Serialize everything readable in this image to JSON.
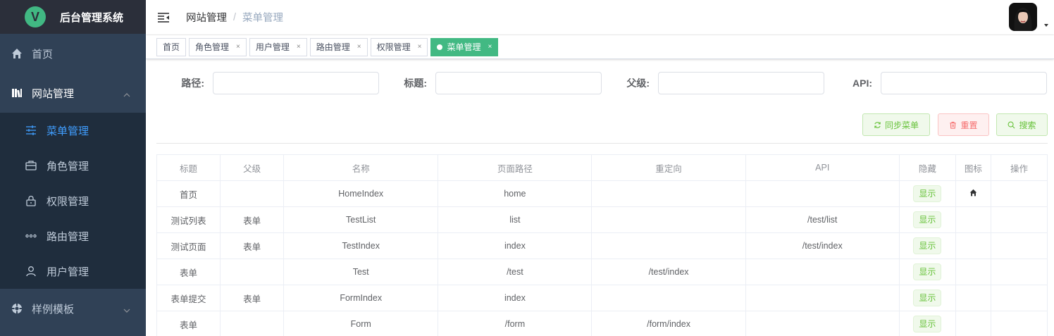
{
  "app": {
    "logo_letter": "V",
    "title": "后台管理系统"
  },
  "sidebar": {
    "home": "首页",
    "site_mgmt": "网站管理",
    "sub_items": [
      "菜单管理",
      "角色管理",
      "权限管理",
      "路由管理",
      "用户管理"
    ],
    "templates": "样例模板"
  },
  "breadcrumb": {
    "parent": "网站管理",
    "separator": "/",
    "current": "菜单管理"
  },
  "tags": [
    "首页",
    "角色管理",
    "用户管理",
    "路由管理",
    "权限管理",
    "菜单管理"
  ],
  "tag_close": "×",
  "filters": {
    "path_label": "路径:",
    "title_label": "标题:",
    "parent_label": "父级:",
    "api_label": "API:"
  },
  "buttons": {
    "sync": "同步菜单",
    "reset": "重置",
    "search": "搜索"
  },
  "colors": {
    "sidebar_bg": "#304156",
    "active_link": "#409eff",
    "active_tag": "#42b983",
    "success": "#67c23a",
    "danger": "#f56c6c"
  },
  "table": {
    "headers": [
      "标题",
      "父级",
      "名称",
      "页面路径",
      "重定向",
      "API",
      "隐藏",
      "图标",
      "操作"
    ],
    "show_label": "显示",
    "rows": [
      {
        "title": "首页",
        "parent": "",
        "name": "HomeIndex",
        "path": "home",
        "redirect": "",
        "api": "",
        "icon": "home-icon"
      },
      {
        "title": "测试列表",
        "parent": "表单",
        "name": "TestList",
        "path": "list",
        "redirect": "",
        "api": "/test/list",
        "icon": ""
      },
      {
        "title": "测试页面",
        "parent": "表单",
        "name": "TestIndex",
        "path": "index",
        "redirect": "",
        "api": "/test/index",
        "icon": ""
      },
      {
        "title": "表单",
        "parent": "",
        "name": "Test",
        "path": "/test",
        "redirect": "/test/index",
        "api": "",
        "icon": ""
      },
      {
        "title": "表单提交",
        "parent": "表单",
        "name": "FormIndex",
        "path": "index",
        "redirect": "",
        "api": "",
        "icon": ""
      },
      {
        "title": "表单",
        "parent": "",
        "name": "Form",
        "path": "/form",
        "redirect": "/form/index",
        "api": "",
        "icon": ""
      }
    ]
  }
}
